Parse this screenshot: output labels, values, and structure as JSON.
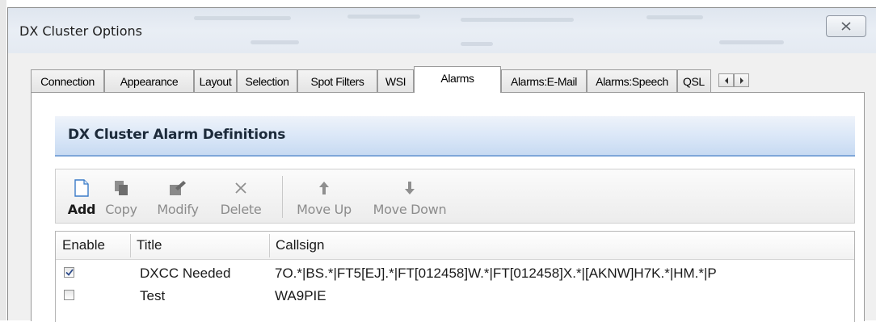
{
  "window": {
    "title": "DX Cluster Options"
  },
  "tabs": [
    {
      "label": "Connection",
      "active": false
    },
    {
      "label": "Appearance",
      "active": false
    },
    {
      "label": "Layout",
      "active": false
    },
    {
      "label": "Selection",
      "active": false
    },
    {
      "label": "Spot Filters",
      "active": false
    },
    {
      "label": "WSI",
      "active": false
    },
    {
      "label": "Alarms",
      "active": true
    },
    {
      "label": "Alarms:E-Mail",
      "active": false
    },
    {
      "label": "Alarms:Speech",
      "active": false
    },
    {
      "label": "QSL",
      "active": false
    }
  ],
  "panel": {
    "title": "DX Cluster Alarm Definitions"
  },
  "toolbar": {
    "add": {
      "label": "Add",
      "icon": "new-document-icon",
      "enabled": true
    },
    "copy": {
      "label": "Copy",
      "icon": "copy-icon",
      "enabled": false
    },
    "modify": {
      "label": "Modify",
      "icon": "modify-icon",
      "enabled": false
    },
    "delete": {
      "label": "Delete",
      "icon": "delete-x-icon",
      "enabled": false
    },
    "move_up": {
      "label": "Move Up",
      "icon": "arrow-up-icon",
      "enabled": false
    },
    "move_down": {
      "label": "Move Down",
      "icon": "arrow-down-icon",
      "enabled": false
    }
  },
  "grid": {
    "columns": [
      "Enable",
      "Title",
      "Callsign"
    ],
    "rows": [
      {
        "enabled": true,
        "title": "DXCC Needed",
        "callsign": "7O.*|BS.*|FT5[EJ].*|FT[012458]W.*|FT[012458]X.*|[AKNW]H7K.*|HM.*|P"
      },
      {
        "enabled": false,
        "title": "Test",
        "callsign": "WA9PIE"
      }
    ]
  },
  "colors": {
    "header_gradient_bottom": "#c7daf2",
    "header_border": "#7ea6d9",
    "window_bg": "#f0f0f0"
  }
}
